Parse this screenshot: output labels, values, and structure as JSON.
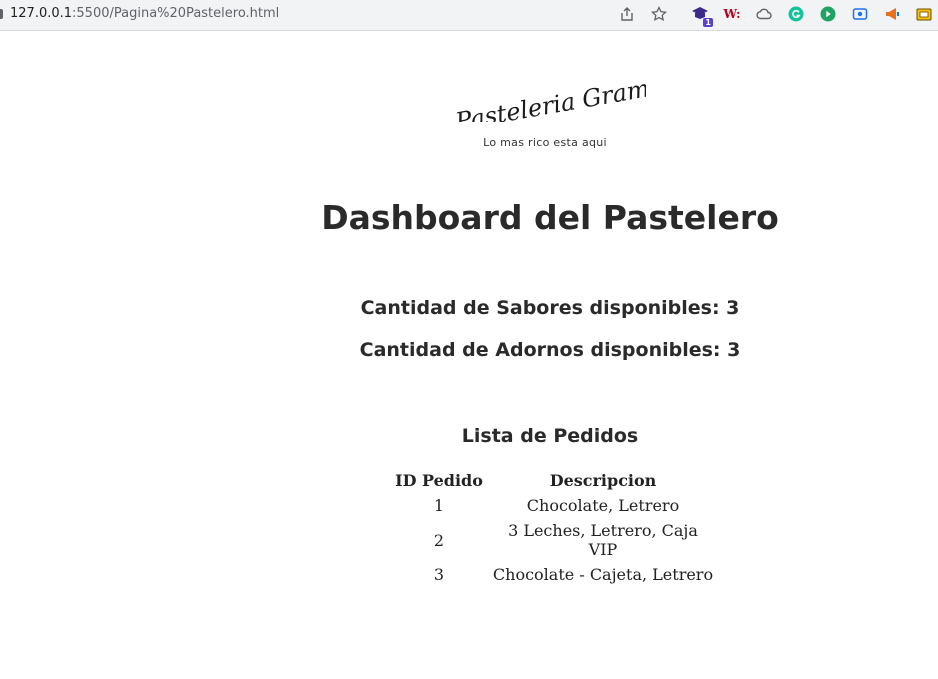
{
  "browser": {
    "url_host": "127.0.0.1",
    "url_rest": ":5500/Pagina%20Pastelero.html",
    "extension_badge": "1",
    "extension_w_label": "W:"
  },
  "header": {
    "logo_text": "Pasteleria Gramblet",
    "tagline": "Lo mas rico esta aqui"
  },
  "main": {
    "title": "Dashboard del Pastelero",
    "sabores_label": "Cantidad de Sabores disponibles: 3",
    "adornos_label": "Cantidad de Adornos disponibles: 3",
    "orders_title": "Lista de Pedidos",
    "table": {
      "headers": [
        "ID Pedido",
        "Descripcion"
      ],
      "rows": [
        [
          "1",
          "Chocolate, Letrero"
        ],
        [
          "2",
          "3 Leches, Letrero, Caja VIP"
        ],
        [
          "3",
          "Chocolate - Cajeta, Letrero"
        ]
      ]
    }
  }
}
